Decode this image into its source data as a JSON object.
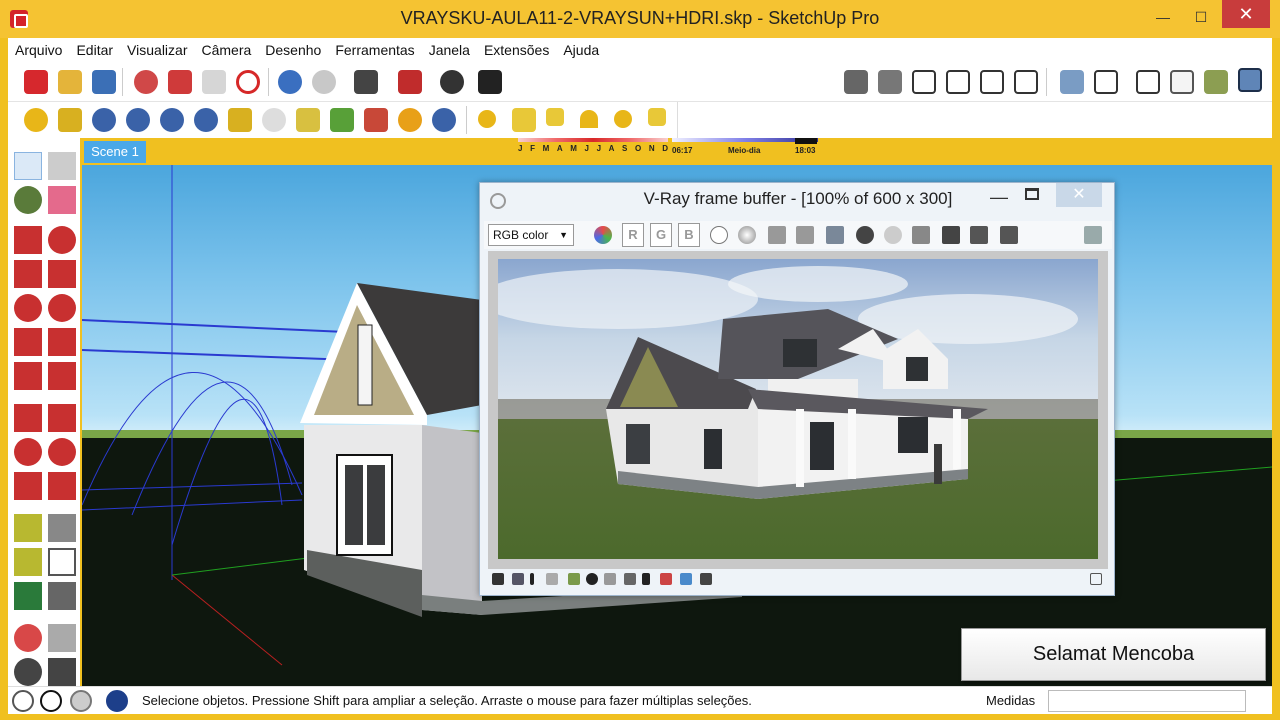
{
  "window": {
    "title": "VRAYSKU-AULA11-2-VRAYSUN+HDRI.skp - SketchUp Pro",
    "minimize": "—",
    "maximize": "☐",
    "close": "✕"
  },
  "menu": [
    "Arquivo",
    "Editar",
    "Visualizar",
    "Câmera",
    "Desenho",
    "Ferramentas",
    "Janela",
    "Extensões",
    "Ajuda"
  ],
  "shadows": {
    "months": [
      "J",
      "F",
      "M",
      "A",
      "M",
      "J",
      "J",
      "A",
      "S",
      "O",
      "N",
      "D"
    ],
    "time_start": "06:17",
    "time_mid": "Meio-dia",
    "time_end": "18:03"
  },
  "scene_tab": "Scene 1",
  "vfb": {
    "title": "V-Ray frame buffer - [100% of 600 x 300]",
    "minimize": "—",
    "close": "✕",
    "channel_select": "RGB color",
    "channels": [
      "R",
      "G",
      "B"
    ]
  },
  "caption": "Selamat Mencoba",
  "status": {
    "message": "Selecione objetos. Pressione Shift para ampliar a seleção. Arraste o mouse para fazer múltiplas seleções.",
    "measures_label": "Medidas"
  },
  "colors": {
    "title_bar": "#f5c332",
    "close_button": "#c83c3c",
    "scene_tab": "#4aa8e8",
    "sky": "#7cc3ec",
    "ground": "#131d12"
  }
}
